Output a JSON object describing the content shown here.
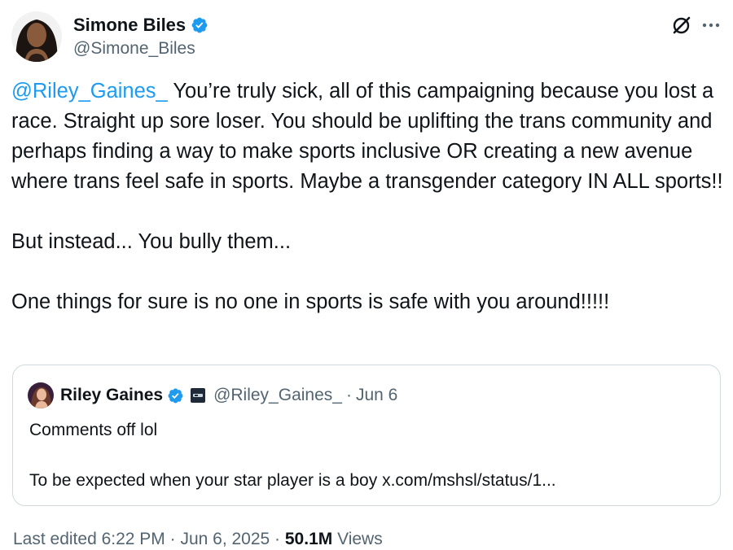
{
  "author": {
    "display_name": "Simone Biles",
    "handle": "@Simone_Biles",
    "verified": true
  },
  "tweet": {
    "mention": "@Riley_Gaines_",
    "line1_rest": " You’re truly sick, all of this campaigning because you lost a race. Straight up sore loser. You should be uplifting the trans community and perhaps finding a way to make sports inclusive OR creating a new avenue where trans feel safe in sports. Maybe a transgender category IN ALL sports!!",
    "paragraph2": "But instead... You bully them...",
    "paragraph3": "One things for sure is no one in sports is safe with you around!!!!!"
  },
  "quoted_tweet": {
    "display_name": "Riley Gaines",
    "handle": "@Riley_Gaines_",
    "separator": "·",
    "date": "Jun 6",
    "verified": true,
    "line1": "Comments off lol",
    "line2": "To be expected when your star player is a boy x.com/mshsl/status/1..."
  },
  "footer": {
    "edited_label": "Last edited 6:22 PM · Jun 6, 2025 · ",
    "views_count": "50.1M",
    "views_label": " Views"
  },
  "icons": {
    "verified": "verified-badge-icon",
    "grok": "grok-icon",
    "more": "more-horizontal-icon",
    "affiliate": "affiliate-badge-icon"
  },
  "colors": {
    "accent": "#1d9bf0",
    "text": "#0f1419",
    "secondary": "#536471",
    "border": "#cfd9de"
  }
}
